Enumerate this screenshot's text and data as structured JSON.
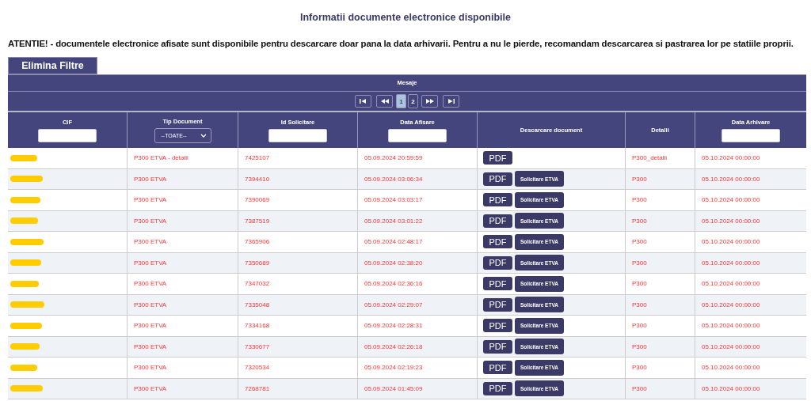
{
  "title": "Informatii documente electronice disponibile",
  "warning": "ATENTIE! - documentele electronice afisate sunt disponibile pentru descarcare doar pana la data arhivarii. Pentru a nu le pierde, recomandam descarcarea si pastrarea lor pe statiile proprii.",
  "clear_filters_button": "Elimina Filtre",
  "table": {
    "caption": "Mesaje",
    "pager": {
      "pages": [
        {
          "label": "1",
          "selected": true
        },
        {
          "label": "2",
          "selected": false
        }
      ]
    },
    "columns": [
      {
        "label": "CIF",
        "kind": "input"
      },
      {
        "label": "Tip Document",
        "kind": "select",
        "value": "--TOATE--"
      },
      {
        "label": "Id Solicitare",
        "kind": "input"
      },
      {
        "label": "Data Afisare",
        "kind": "input"
      },
      {
        "label": "Descarcare document",
        "kind": "plain"
      },
      {
        "label": "Detalii",
        "kind": "plain"
      },
      {
        "label": "Data Arhivare",
        "kind": "input"
      }
    ],
    "rows": [
      {
        "tip": "P300 ETVA - detalii",
        "id": "7425107",
        "afisare": "05.09.2024 20:59:59",
        "buttons": [
          "PDF"
        ],
        "detalii": "P300_detalii",
        "arhivare": "05.10.2024 00:00:00"
      },
      {
        "tip": "P300 ETVA",
        "id": "7394410",
        "afisare": "05.09.2024 03:06:34",
        "buttons": [
          "PDF",
          "Solicitare ETVA"
        ],
        "detalii": "P300",
        "arhivare": "05.10.2024 00:00:00"
      },
      {
        "tip": "P300 ETVA",
        "id": "7390069",
        "afisare": "05.09.2024 03:03:17",
        "buttons": [
          "PDF",
          "Solicitare ETVA"
        ],
        "detalii": "P300",
        "arhivare": "05.10.2024 00:00:00"
      },
      {
        "tip": "P300 ETVA",
        "id": "7387519",
        "afisare": "05.09.2024 03:01:22",
        "buttons": [
          "PDF",
          "Solicitare ETVA"
        ],
        "detalii": "P300",
        "arhivare": "05.10.2024 00:00:00"
      },
      {
        "tip": "P300 ETVA",
        "id": "7365906",
        "afisare": "05.09.2024 02:48:17",
        "buttons": [
          "PDF",
          "Solicitare ETVA"
        ],
        "detalii": "P300",
        "arhivare": "05.10.2024 00:00:00"
      },
      {
        "tip": "P300 ETVA",
        "id": "7350689",
        "afisare": "05.09.2024 02:38:20",
        "buttons": [
          "PDF",
          "Solicitare ETVA"
        ],
        "detalii": "P300",
        "arhivare": "05.10.2024 00:00:00"
      },
      {
        "tip": "P300 ETVA",
        "id": "7347032",
        "afisare": "05.09.2024 02:36:16",
        "buttons": [
          "PDF",
          "Solicitare ETVA"
        ],
        "detalii": "P300",
        "arhivare": "05.10.2024 00:00:00"
      },
      {
        "tip": "P300 ETVA",
        "id": "7335048",
        "afisare": "05.09.2024 02:29:07",
        "buttons": [
          "PDF",
          "Solicitare ETVA"
        ],
        "detalii": "P300",
        "arhivare": "05.10.2024 00:00:00"
      },
      {
        "tip": "P300 ETVA",
        "id": "7334168",
        "afisare": "05.09.2024 02:28:31",
        "buttons": [
          "PDF",
          "Solicitare ETVA"
        ],
        "detalii": "P300",
        "arhivare": "05.10.2024 00:00:00"
      },
      {
        "tip": "P300 ETVA",
        "id": "7330677",
        "afisare": "05.09.2024 02:26:18",
        "buttons": [
          "PDF",
          "Solicitare ETVA"
        ],
        "detalii": "P300",
        "arhivare": "05.10.2024 00:00:00"
      },
      {
        "tip": "P300 ETVA",
        "id": "7320534",
        "afisare": "05.09.2024 02:19:23",
        "buttons": [
          "PDF",
          "Solicitare ETVA"
        ],
        "detalii": "P300",
        "arhivare": "05.10.2024 00:00:00"
      },
      {
        "tip": "P300 ETVA",
        "id": "7268781",
        "afisare": "05.09.2024 01:45:09",
        "buttons": [
          "PDF",
          "Solicitare ETVA"
        ],
        "detalii": "P300",
        "arhivare": "05.10.2024 00:00:00"
      }
    ]
  }
}
